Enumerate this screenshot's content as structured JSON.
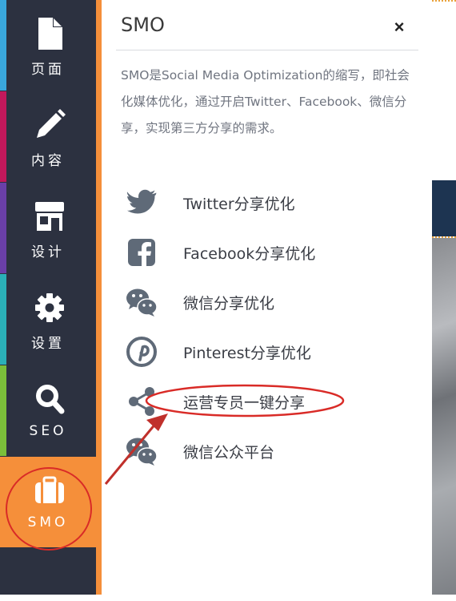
{
  "sidebar": {
    "items": [
      {
        "label": "页面",
        "icon": "page-icon",
        "stripe": "#3aa7dc"
      },
      {
        "label": "内容",
        "icon": "pencil-icon",
        "stripe": "#c2185b"
      },
      {
        "label": "设计",
        "icon": "store-icon",
        "stripe": "#6a3fa8"
      },
      {
        "label": "设置",
        "icon": "gear-icon",
        "stripe": "#2bb0b8"
      },
      {
        "label": "SEO",
        "icon": "search-icon",
        "stripe": "#7bbf3a"
      },
      {
        "label": "SMO",
        "icon": "briefcase-icon",
        "stripe": "#f58f3a"
      }
    ]
  },
  "panel": {
    "title": "SMO",
    "close": "×",
    "description": "SMO是Social Media Optimization的缩写，即社会化媒体优化，通过开启Twitter、Facebook、微信分享，实现第三方分享的需求。",
    "features": [
      {
        "label": "Twitter分享优化",
        "icon": "twitter-icon"
      },
      {
        "label": "Facebook分享优化",
        "icon": "facebook-icon"
      },
      {
        "label": "微信分享优化",
        "icon": "wechat-icon"
      },
      {
        "label": "Pinterest分享优化",
        "icon": "pinterest-icon"
      },
      {
        "label": "运营专员一键分享",
        "icon": "share-icon"
      },
      {
        "label": "微信公众平台",
        "icon": "wechat-icon"
      }
    ]
  },
  "colors": {
    "sidebar_bg": "#2c3140",
    "accent": "#f58f3a",
    "icon_gray": "#5f6a78",
    "annotation_red": "#d92b27"
  }
}
